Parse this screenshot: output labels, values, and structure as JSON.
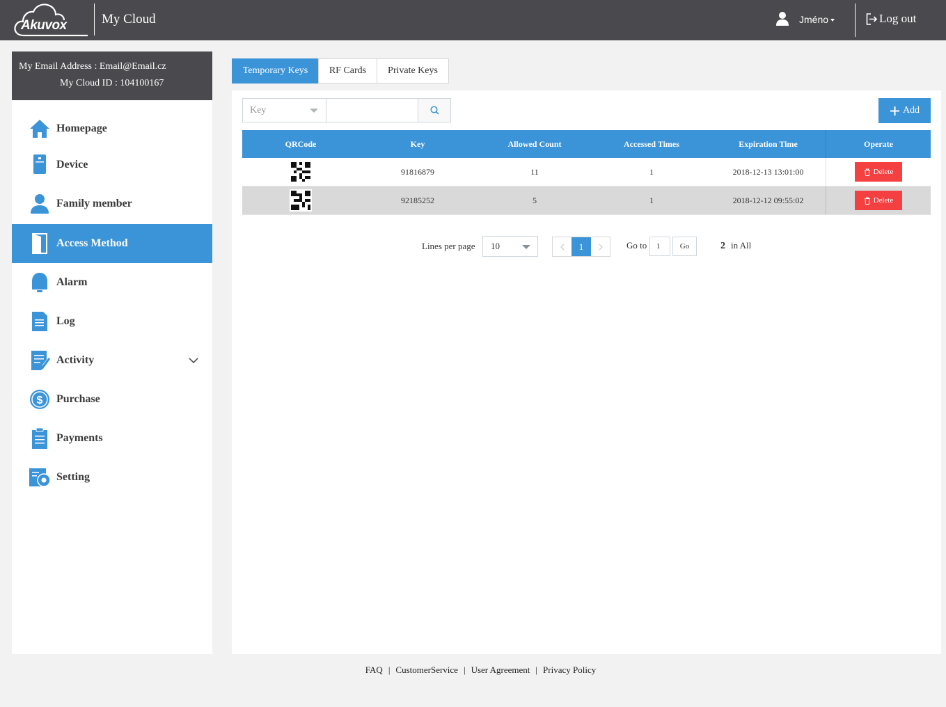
{
  "header": {
    "logo_text": "Akuvox",
    "app_title": "My Cloud",
    "user_name": "Jméno",
    "logout_label": "Log out"
  },
  "account": {
    "email_line": "My Email Address : Email@Email.cz",
    "cloud_id_line": "My Cloud ID : 104100167"
  },
  "sidebar": {
    "items": [
      {
        "label": "Homepage",
        "icon": "home-icon"
      },
      {
        "label": "Device",
        "icon": "device-icon"
      },
      {
        "label": "Family member",
        "icon": "person-icon"
      },
      {
        "label": "Access Method",
        "icon": "door-icon",
        "active": true
      },
      {
        "label": "Alarm",
        "icon": "bell-icon"
      },
      {
        "label": "Log",
        "icon": "document-icon"
      },
      {
        "label": "Activity",
        "icon": "edit-list-icon",
        "expandable": true
      },
      {
        "label": "Purchase",
        "icon": "dollar-icon"
      },
      {
        "label": "Payments",
        "icon": "clipboard-icon"
      },
      {
        "label": "Setting",
        "icon": "settings-icon"
      }
    ]
  },
  "tabs": [
    {
      "label": "Temporary Keys",
      "active": true
    },
    {
      "label": "RF Cards"
    },
    {
      "label": "Private Keys"
    }
  ],
  "filter": {
    "select_value": "Key",
    "search_value": ""
  },
  "add_label": "Add",
  "table": {
    "headers": [
      "QRCode",
      "Key",
      "Allowed Count",
      "Accessed Times",
      "Expiration Time",
      "Operate"
    ],
    "rows": [
      {
        "key": "91816879",
        "allowed_count": "11",
        "accessed_times": "1",
        "expiration": "2018-12-13 13:01:00",
        "action": "Delete"
      },
      {
        "key": "92185252",
        "allowed_count": "5",
        "accessed_times": "1",
        "expiration": "2018-12-12 09:55:02",
        "action": "Delete"
      }
    ]
  },
  "pagination": {
    "lines_label": "Lines per page",
    "lines_value": "10",
    "current_page": "1",
    "goto_label": "Go to",
    "goto_value": "1",
    "go_label": "Go",
    "total_count": "2",
    "total_suffix": "in All"
  },
  "footer": {
    "links": [
      "FAQ",
      "CustomerService",
      "User Agreement",
      "Privacy Policy"
    ]
  },
  "colors": {
    "accent": "#3b93d8",
    "header_bg": "#4a494d",
    "danger": "#f44040"
  }
}
